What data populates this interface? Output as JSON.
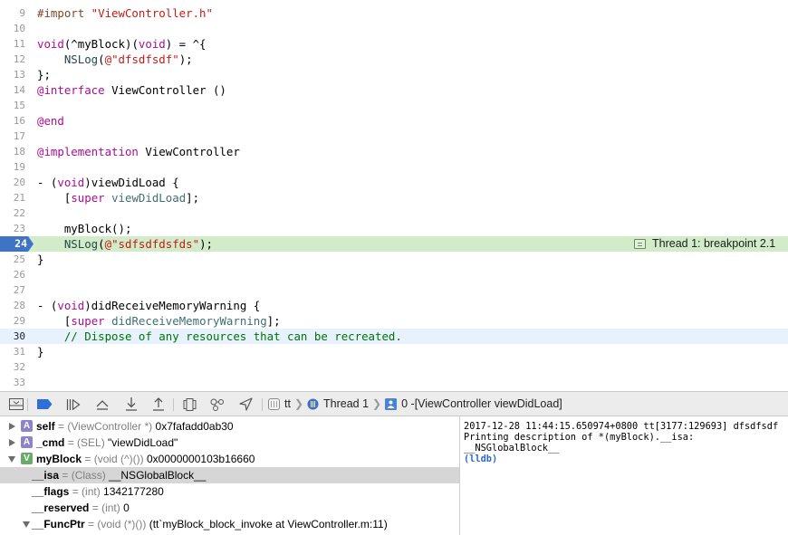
{
  "editor": {
    "lines": [
      {
        "num": "9",
        "code": "#import \"ViewController.h\""
      },
      {
        "num": "10",
        "code": ""
      },
      {
        "num": "11",
        "code": "void(^myBlock)(void) = ^{"
      },
      {
        "num": "12",
        "code": "    NSLog(@\"dfsdfsdf\");"
      },
      {
        "num": "13",
        "code": "};"
      },
      {
        "num": "14",
        "code": "@interface ViewController ()"
      },
      {
        "num": "15",
        "code": ""
      },
      {
        "num": "16",
        "code": "@end"
      },
      {
        "num": "17",
        "code": ""
      },
      {
        "num": "18",
        "code": "@implementation ViewController"
      },
      {
        "num": "19",
        "code": ""
      },
      {
        "num": "20",
        "code": "- (void)viewDidLoad {"
      },
      {
        "num": "21",
        "code": "    [super viewDidLoad];"
      },
      {
        "num": "22",
        "code": ""
      },
      {
        "num": "23",
        "code": "    myBlock();"
      },
      {
        "num": "24",
        "code": "    NSLog(@\"sdfsdfdsfds\");"
      },
      {
        "num": "25",
        "code": "}"
      },
      {
        "num": "26",
        "code": ""
      },
      {
        "num": "27",
        "code": ""
      },
      {
        "num": "28",
        "code": "- (void)didReceiveMemoryWarning {"
      },
      {
        "num": "29",
        "code": "    [super didReceiveMemoryWarning];"
      },
      {
        "num": "30",
        "code": "    // Dispose of any resources that can be recreated."
      },
      {
        "num": "31",
        "code": "}"
      },
      {
        "num": "32",
        "code": ""
      },
      {
        "num": "33",
        "code": ""
      }
    ],
    "breakpoint_line": "24",
    "current_line": "30",
    "thread_annotation": "Thread 1: breakpoint 2.1",
    "colors": {
      "keyword": "#aa0d91",
      "string": "#c41a16",
      "class": "#3f6e74",
      "comment": "#007400",
      "breakpoint_highlight": "#d2ebc9",
      "breakpoint_marker": "#3f73c6",
      "current_line": "#e8f2fe"
    }
  },
  "debug_bar": {
    "buttons": [
      {
        "icon": "hide-debug-area-icon"
      },
      {
        "icon": "breakpoints-toggle-icon"
      },
      {
        "icon": "continue-icon"
      },
      {
        "icon": "step-over-icon"
      },
      {
        "icon": "step-into-icon"
      },
      {
        "icon": "step-out-icon"
      },
      {
        "icon": "view-hierarchy-icon"
      },
      {
        "icon": "memory-graph-icon"
      },
      {
        "icon": "simulate-location-icon"
      }
    ],
    "breadcrumb": {
      "app": "tt",
      "thread": "Thread 1",
      "frame": "0 -[ViewController viewDidLoad]"
    }
  },
  "variables": [
    {
      "badge": "A",
      "expand": "right",
      "name": "self",
      "type": "(ViewController *)",
      "value": "0x7fafadd0ab30"
    },
    {
      "badge": "A",
      "expand": "right",
      "name": "_cmd",
      "type": "(SEL)",
      "value": "\"viewDidLoad\""
    },
    {
      "badge": "V",
      "expand": "down",
      "name": "myBlock",
      "type": "(void (^)())",
      "value": "0x0000000103b16660"
    },
    {
      "badge": "",
      "expand": "",
      "name": "__isa",
      "type": "(Class)",
      "value": "__NSGlobalBlock__",
      "selected": true
    },
    {
      "badge": "",
      "expand": "",
      "name": "__flags",
      "type": "(int)",
      "value": "1342177280"
    },
    {
      "badge": "",
      "expand": "",
      "name": "__reserved",
      "type": "(int)",
      "value": "0"
    },
    {
      "badge": "",
      "expand": "down",
      "name": "__FuncPtr",
      "type": "(void (*)())",
      "value": "(tt`myBlock_block_invoke at ViewController.m:11)"
    }
  ],
  "console": {
    "lines": [
      "2017-12-28 11:44:15.650974+0800 tt[3177:129693] dfsdfsdf",
      "Printing description of *(myBlock).__isa:",
      "__NSGlobalBlock__"
    ],
    "prompt": "(lldb)"
  }
}
